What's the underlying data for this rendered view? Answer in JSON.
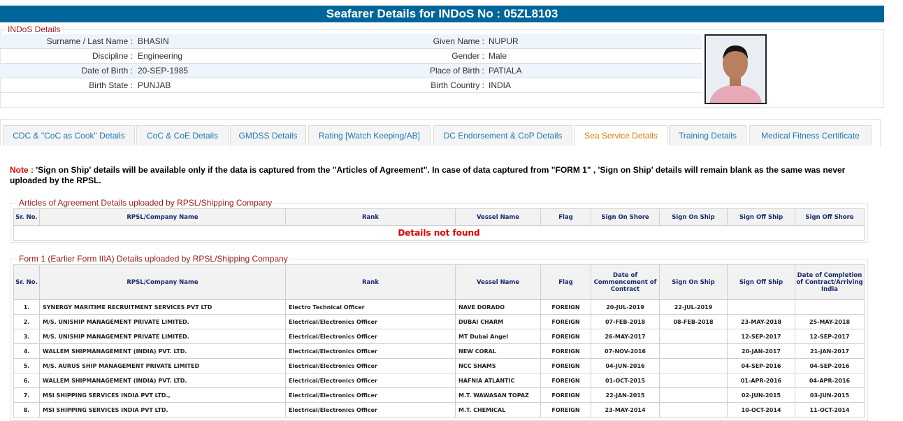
{
  "title": "Seafarer Details for INDoS No : 05ZL8103",
  "indos": {
    "legend": "INDoS Details",
    "rows": [
      {
        "l1": "Surname / Last Name :",
        "v1": "BHASIN",
        "l2": "Given Name :",
        "v2": "NUPUR"
      },
      {
        "l1": "Discipline :",
        "v1": "Engineering",
        "l2": "Gender :",
        "v2": "Male"
      },
      {
        "l1": "Date of Birth :",
        "v1": "20-SEP-1985",
        "l2": "Place of Birth :",
        "v2": "PATIALA"
      },
      {
        "l1": "Birth State :",
        "v1": "PUNJAB",
        "l2": "Birth Country :",
        "v2": "INDIA"
      }
    ]
  },
  "tabs": [
    "CDC & \"CoC as Cook\" Details",
    "CoC & CoE Details",
    "GMDSS Details",
    "Rating [Watch Keeping/AB]",
    "DC Endorsement & CoP Details",
    "Sea Service Details",
    "Training Details",
    "Medical Fitness Certificate"
  ],
  "note": {
    "prefix": "Note :",
    "text": " 'Sign on Ship' details will be available only if the data is captured from the \"Articles of Agreement\". In case of data captured from \"FORM 1\" , 'Sign on Ship' details will remain blank as the same was never uploaded by the RPSL."
  },
  "articles": {
    "legend": "Articles of Agreement Details uploaded by RPSL/Shipping Company",
    "headers": [
      "Sr. No.",
      "RPSL/Company Name",
      "Rank",
      "Vessel Name",
      "Flag",
      "Sign On Shore",
      "Sign On Ship",
      "Sign Off Ship",
      "Sign Off Shore"
    ],
    "empty": "Details not found"
  },
  "form1": {
    "legend": "Form 1 (Earlier Form IIIA) Details uploaded by RPSL/Shipping Company",
    "headers": [
      "Sr. No.",
      "RPSL/Company Name",
      "Rank",
      "Vessel Name",
      "Flag",
      "Date of Commencement of Contract",
      "Sign On Ship",
      "Sign Off Ship",
      "Date of Completion of Contract/Arriving India"
    ],
    "rows": [
      [
        "1.",
        "SYNERGY MARITIME RECRUITMENT SERVICES PVT LTD",
        "Electro Technical Officer",
        "NAVE DORADO",
        "FOREIGN",
        "20-JUL-2019",
        "22-JUL-2019",
        "",
        ""
      ],
      [
        "2.",
        "M/S. UNISHIP MANAGEMENT PRIVATE LIMITED.",
        "Electrical/Electronics Officer",
        "DUBAI CHARM",
        "FOREIGN",
        "07-FEB-2018",
        "08-FEB-2018",
        "23-MAY-2018",
        "25-MAY-2018"
      ],
      [
        "3.",
        "M/S. UNISHIP MANAGEMENT PRIVATE LIMITED.",
        "Electrical/Electronics Officer",
        "MT Dubai Angel",
        "FOREIGN",
        "26-MAY-2017",
        "",
        "12-SEP-2017",
        "12-SEP-2017"
      ],
      [
        "4.",
        "WALLEM SHIPMANAGEMENT (INDIA) PVT. LTD.",
        "Electrical/Electronics Officer",
        "NEW CORAL",
        "FOREIGN",
        "07-NOV-2016",
        "",
        "20-JAN-2017",
        "21-JAN-2017"
      ],
      [
        "5.",
        "M/S. AURUS SHIP MANAGEMENT PRIVATE LIMITED",
        "Electrical/Electronics Officer",
        "NCC SHAMS",
        "FOREIGN",
        "04-JUN-2016",
        "",
        "04-SEP-2016",
        "04-SEP-2016"
      ],
      [
        "6.",
        "WALLEM SHIPMANAGEMENT (INDIA) PVT. LTD.",
        "Electrical/Electronics Officer",
        "HAFNIA ATLANTIC",
        "FOREIGN",
        "01-OCT-2015",
        "",
        "01-APR-2016",
        "04-APR-2016"
      ],
      [
        "7.",
        "MSI SHIPPING SERVICES INDIA PVT LTD.,",
        "Electrical/Electronics Officer",
        "M.T. WAWASAN TOPAZ",
        "FOREIGN",
        "22-JAN-2015",
        "",
        "02-JUN-2015",
        "03-JUN-2015"
      ],
      [
        "8.",
        "MSI SHIPPING SERVICES INDIA PVT LTD.",
        "Electrical/Electronics Officer",
        "M.T. CHEMICAL",
        "FOREIGN",
        "23-MAY-2014",
        "",
        "10-OCT-2014",
        "11-OCT-2014"
      ]
    ]
  }
}
